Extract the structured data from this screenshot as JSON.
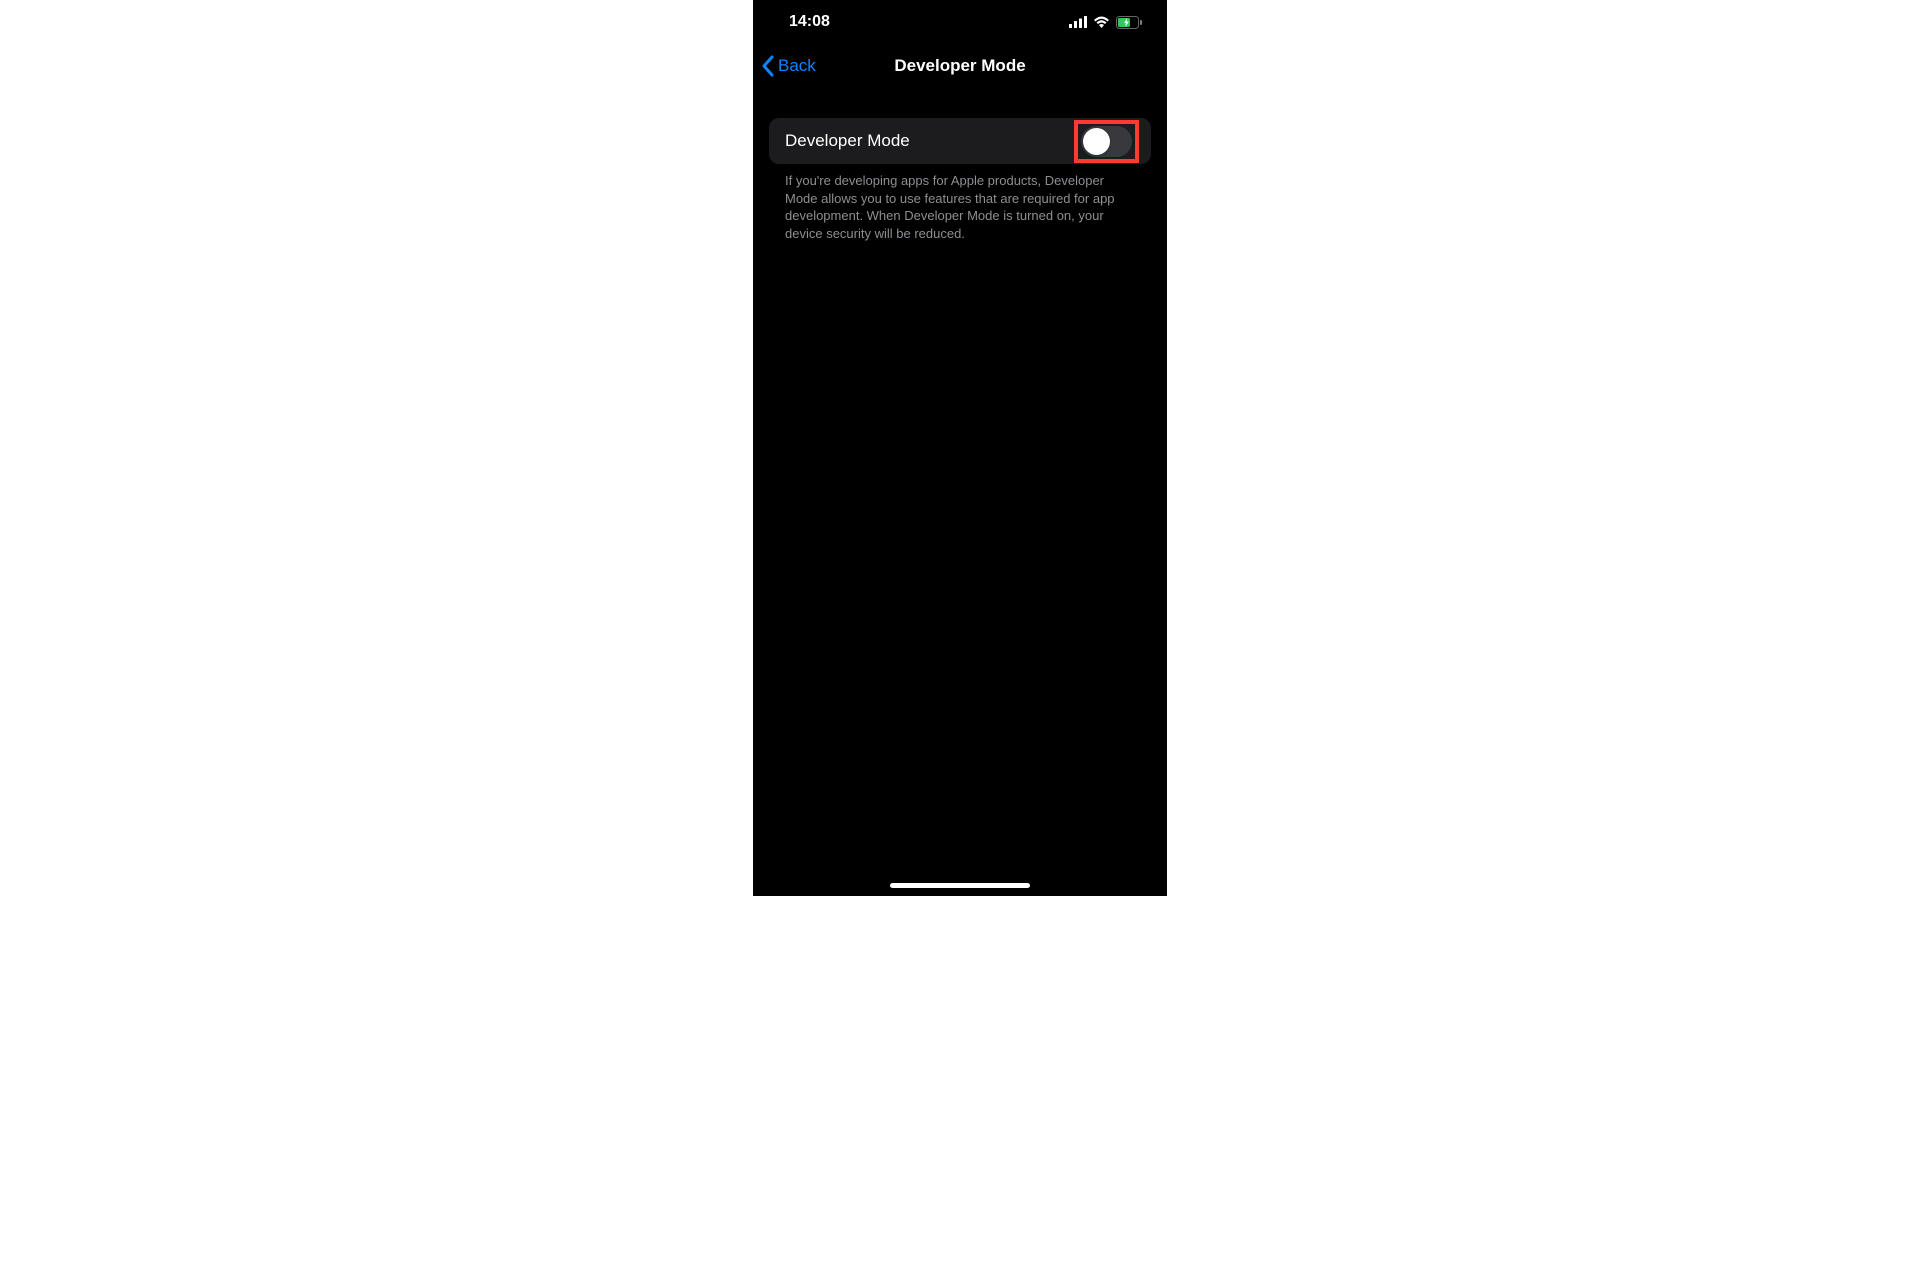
{
  "status": {
    "time": "14:08"
  },
  "nav": {
    "back_label": "Back",
    "title": "Developer Mode"
  },
  "setting": {
    "label": "Developer Mode",
    "toggle_on": false,
    "description": "If you're developing apps for Apple products, Developer Mode allows you to use features that are required for app development. When Developer Mode is turned on, your device security will be reduced."
  },
  "highlight": {
    "color": "#ff3b30"
  }
}
